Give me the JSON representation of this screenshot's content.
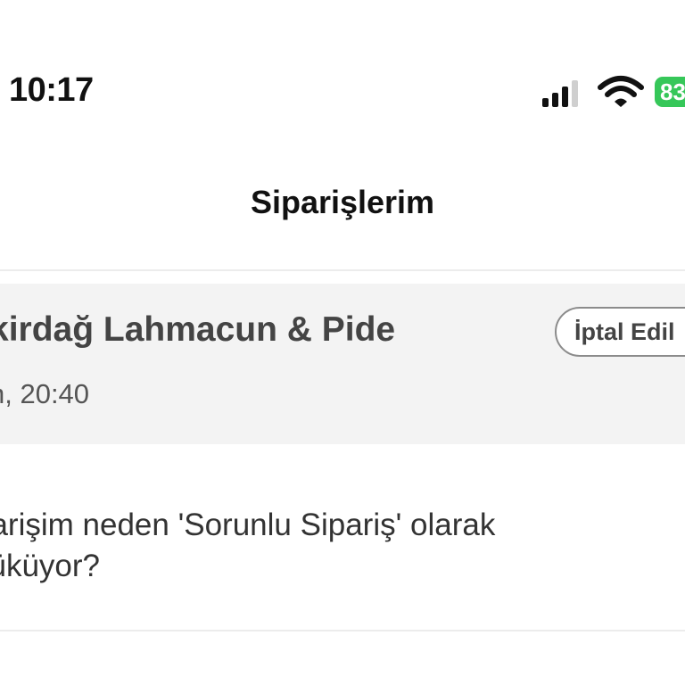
{
  "status_bar": {
    "time": "10:17",
    "battery": "83"
  },
  "header": {
    "title": "Siparişlerim"
  },
  "order": {
    "restaurant": "kirdağ Lahmacun & Pide",
    "date": "n, 20:40",
    "status": "İptal Edil"
  },
  "help": {
    "question": "parişim neden 'Sorunlu Sipariş' olarak\nzüküyor?"
  },
  "colors": {
    "battery_green": "#36c759",
    "card_background": "#f3f3f3"
  },
  "icons": [
    "signal-icon",
    "wifi-icon",
    "battery-icon"
  ]
}
